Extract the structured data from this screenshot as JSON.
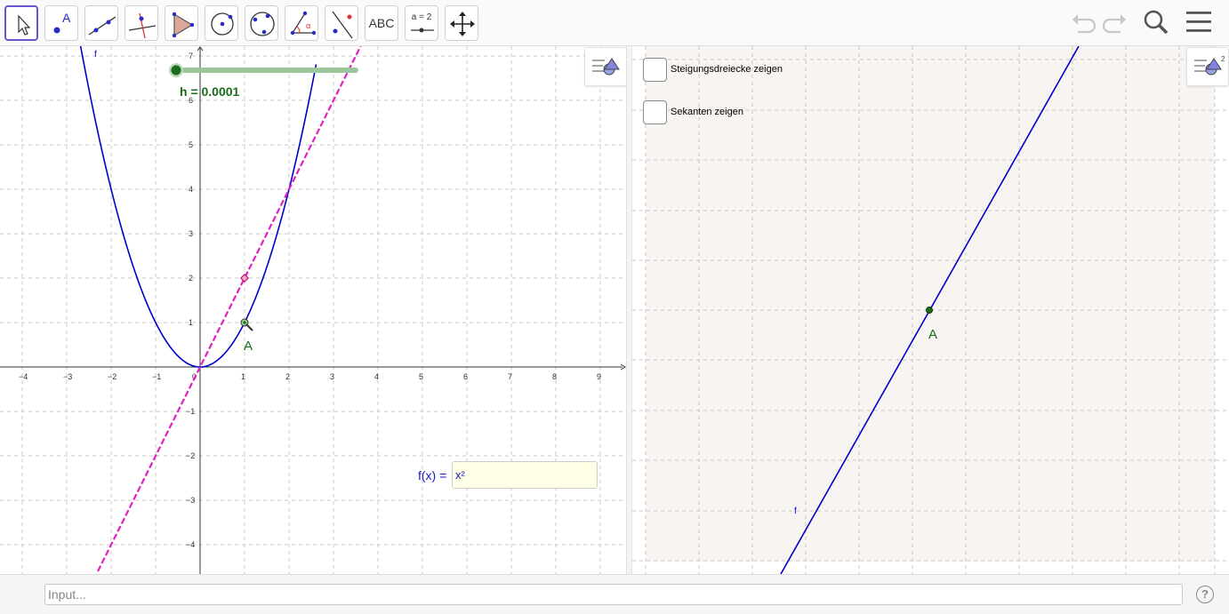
{
  "toolbar": {
    "tools": [
      {
        "name": "move-tool",
        "active": true
      },
      {
        "name": "point-tool",
        "label": "A"
      },
      {
        "name": "line-tool"
      },
      {
        "name": "perpendicular-line-tool"
      },
      {
        "name": "polygon-tool"
      },
      {
        "name": "circle-tool"
      },
      {
        "name": "circle-through-points-tool"
      },
      {
        "name": "angle-tool",
        "label": "α"
      },
      {
        "name": "reflect-tool"
      },
      {
        "name": "text-tool",
        "label": "ABC"
      },
      {
        "name": "slider-tool",
        "label": "a = 2"
      },
      {
        "name": "move-graphics-view-tool"
      }
    ],
    "right_icons": [
      "undo-icon",
      "redo-icon",
      "search-icon",
      "menu-icon"
    ]
  },
  "graphics1": {
    "slider": {
      "label": "h = 0.0001",
      "value": 0.0001
    },
    "function_label": "f",
    "point_label": "A",
    "x_ticks": [
      "−4",
      "−3",
      "−2",
      "−1",
      "0",
      "1",
      "2",
      "3",
      "4",
      "5",
      "6",
      "7",
      "8",
      "9"
    ],
    "y_ticks_pos": [
      "1",
      "2",
      "3",
      "4",
      "5",
      "6",
      "7"
    ],
    "y_ticks_neg": [
      "−1",
      "−2",
      "−3",
      "−4"
    ],
    "input_label": "f(x) =",
    "input_value": "x²",
    "colors": {
      "function": "#0000cc",
      "tangent": "#e020c0",
      "slider": "#1a6b1a",
      "point": "#1a6b1a"
    }
  },
  "graphics2": {
    "checkbox1": {
      "label": "Steigungsdreiecke zeigen",
      "checked": false
    },
    "checkbox2": {
      "label": "Sekanten zeigen",
      "checked": false
    },
    "point_label": "A",
    "function_label": "f",
    "background": "#f8f4f2"
  },
  "input_bar": {
    "placeholder": "Input..."
  },
  "help": {
    "label": "?"
  }
}
